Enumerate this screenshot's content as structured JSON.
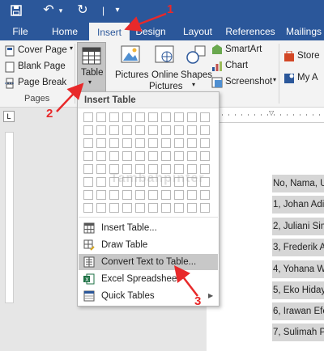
{
  "colors": {
    "accent": "#2b579a",
    "annotation": "#e8292a"
  },
  "tabs": [
    "File",
    "Home",
    "Insert",
    "Design",
    "Layout",
    "References",
    "Mailings"
  ],
  "active_tab": "Insert",
  "ribbon": {
    "pages_group": {
      "cover_page": "Cover Page",
      "blank_page": "Blank Page",
      "page_break": "Page Break",
      "label": "Pages"
    },
    "table_button": "Table",
    "pictures": "Pictures",
    "online_pictures_1": "Online",
    "online_pictures_2": "Pictures",
    "shapes": "Shapes",
    "smartart": "SmartArt",
    "chart": "Chart",
    "screenshot": "Screenshot",
    "store": "Store",
    "my_addins": "My A"
  },
  "dropdown": {
    "header": "Insert Table",
    "items": [
      {
        "label": "Insert Table...",
        "icon": "insert-table-icon"
      },
      {
        "label": "Draw Table",
        "icon": "draw-table-icon"
      },
      {
        "label": "Convert Text to Table...",
        "icon": "convert-table-icon"
      },
      {
        "label": "Excel Spreadsheet",
        "icon": "excel-icon"
      },
      {
        "label": "Quick Tables",
        "icon": "quick-tables-icon"
      }
    ]
  },
  "watermark": "Tambahpinter",
  "document_lines": [
    "No, Nama, U",
    "1, Johan Adiv",
    "2, Juliani Sim",
    "3, Frederik A",
    "4, Yohana W",
    "5, Eko Hiday",
    "6, Irawan Efe",
    "7, Sulimah Pu"
  ],
  "annotations": [
    "1",
    "2",
    "3"
  ]
}
